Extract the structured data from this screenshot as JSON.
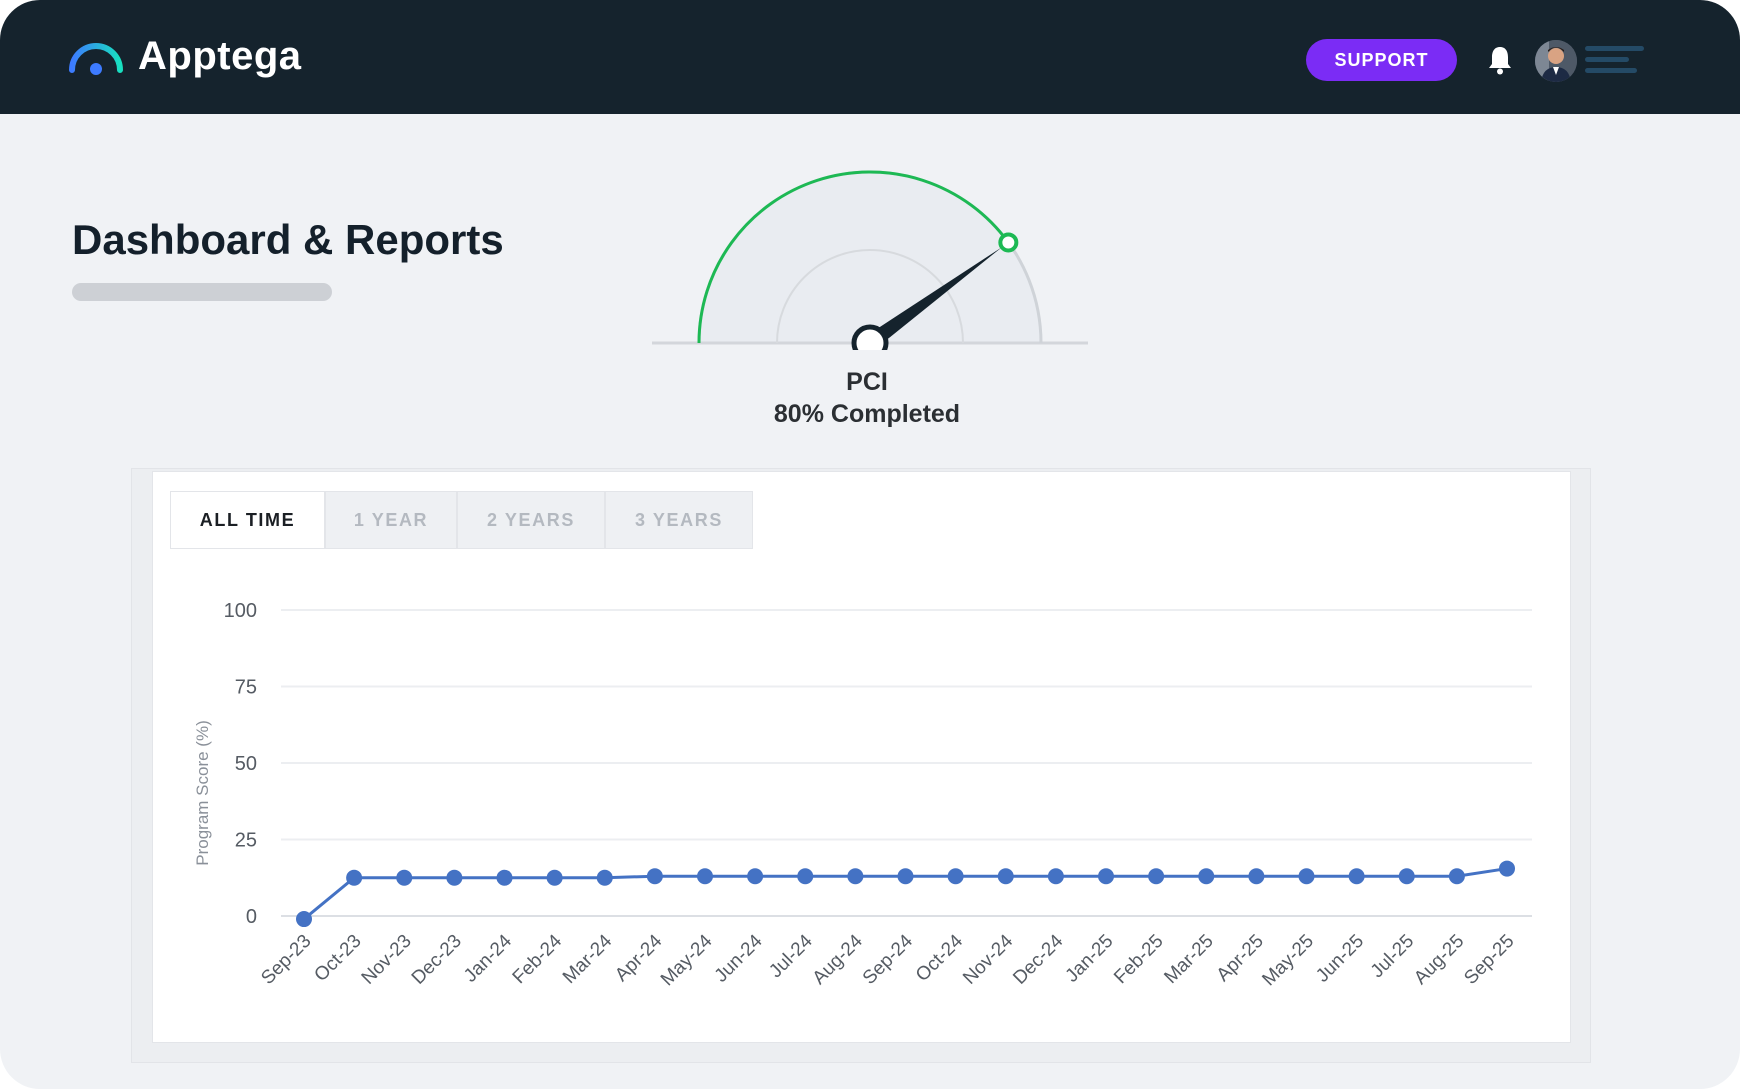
{
  "app": {
    "name": "Apptega"
  },
  "header": {
    "support_label": "SUPPORT"
  },
  "page": {
    "title": "Dashboard & Reports"
  },
  "gauge": {
    "name": "PCI",
    "status_text": "80% Completed",
    "value_percent": 80,
    "colors": {
      "progress": "#1db954",
      "track": "#cfd3d8",
      "needle": "#15232d"
    }
  },
  "tabs": [
    {
      "label": "ALL TIME",
      "active": true
    },
    {
      "label": "1 YEAR",
      "active": false
    },
    {
      "label": "2 YEARS",
      "active": false
    },
    {
      "label": "3 YEARS",
      "active": false
    }
  ],
  "colors": {
    "topbar": "#15232d",
    "accent": "#7b2cf5",
    "series": "#4472c4"
  },
  "chart_data": {
    "type": "line",
    "ylabel": "Program Score (%)",
    "xlabel": "",
    "ylim": [
      0,
      100
    ],
    "yticks": [
      0,
      25,
      50,
      75,
      100
    ],
    "grid": true,
    "x": [
      "Sep-23",
      "Oct-23",
      "Nov-23",
      "Dec-23",
      "Jan-24",
      "Feb-24",
      "Mar-24",
      "Apr-24",
      "May-24",
      "Jun-24",
      "Jul-24",
      "Aug-24",
      "Sep-24",
      "Oct-24",
      "Nov-24",
      "Dec-24",
      "Jan-25",
      "Feb-25",
      "Mar-25",
      "Apr-25",
      "May-25",
      "Jun-25",
      "Jul-25",
      "Aug-25",
      "Sep-25"
    ],
    "series": [
      {
        "values": [
          -1,
          12.5,
          12.5,
          12.5,
          12.5,
          12.5,
          12.5,
          13,
          13,
          13,
          13,
          13,
          13,
          13,
          13,
          13,
          13,
          13,
          13,
          13,
          13,
          13,
          13,
          13,
          15.5
        ]
      }
    ]
  }
}
